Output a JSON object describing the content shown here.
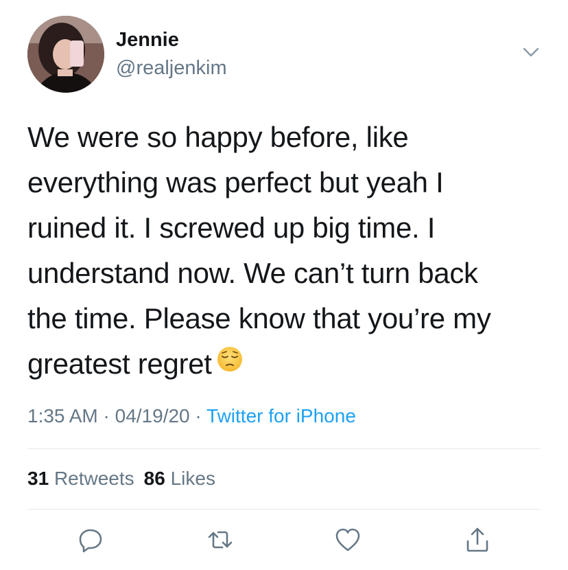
{
  "user": {
    "name": "Jennie",
    "handle": "@realjenkim"
  },
  "tweet": {
    "lines": [
      "We were so happy before, like",
      "everything was perfect but yeah I",
      "ruined it. I screwed up big time. I",
      "understand now. We can’t turn back",
      "the time. Please know that you’re my",
      "greatest regret"
    ],
    "emoji": "pensive-face"
  },
  "meta": {
    "time": "1:35 AM",
    "sep1": " · ",
    "date": "04/19/20",
    "sep2": " · ",
    "source": "Twitter for iPhone"
  },
  "stats": {
    "retweets_count": "31",
    "retweets_label": "Retweets",
    "likes_count": "86",
    "likes_label": "Likes"
  },
  "actions": {
    "icons": [
      "reply-icon",
      "retweet-icon",
      "like-icon",
      "share-icon"
    ]
  },
  "colors": {
    "text": "#14171a",
    "secondary": "#657786",
    "link": "#1da1f2",
    "divider": "#e1e8ed"
  }
}
